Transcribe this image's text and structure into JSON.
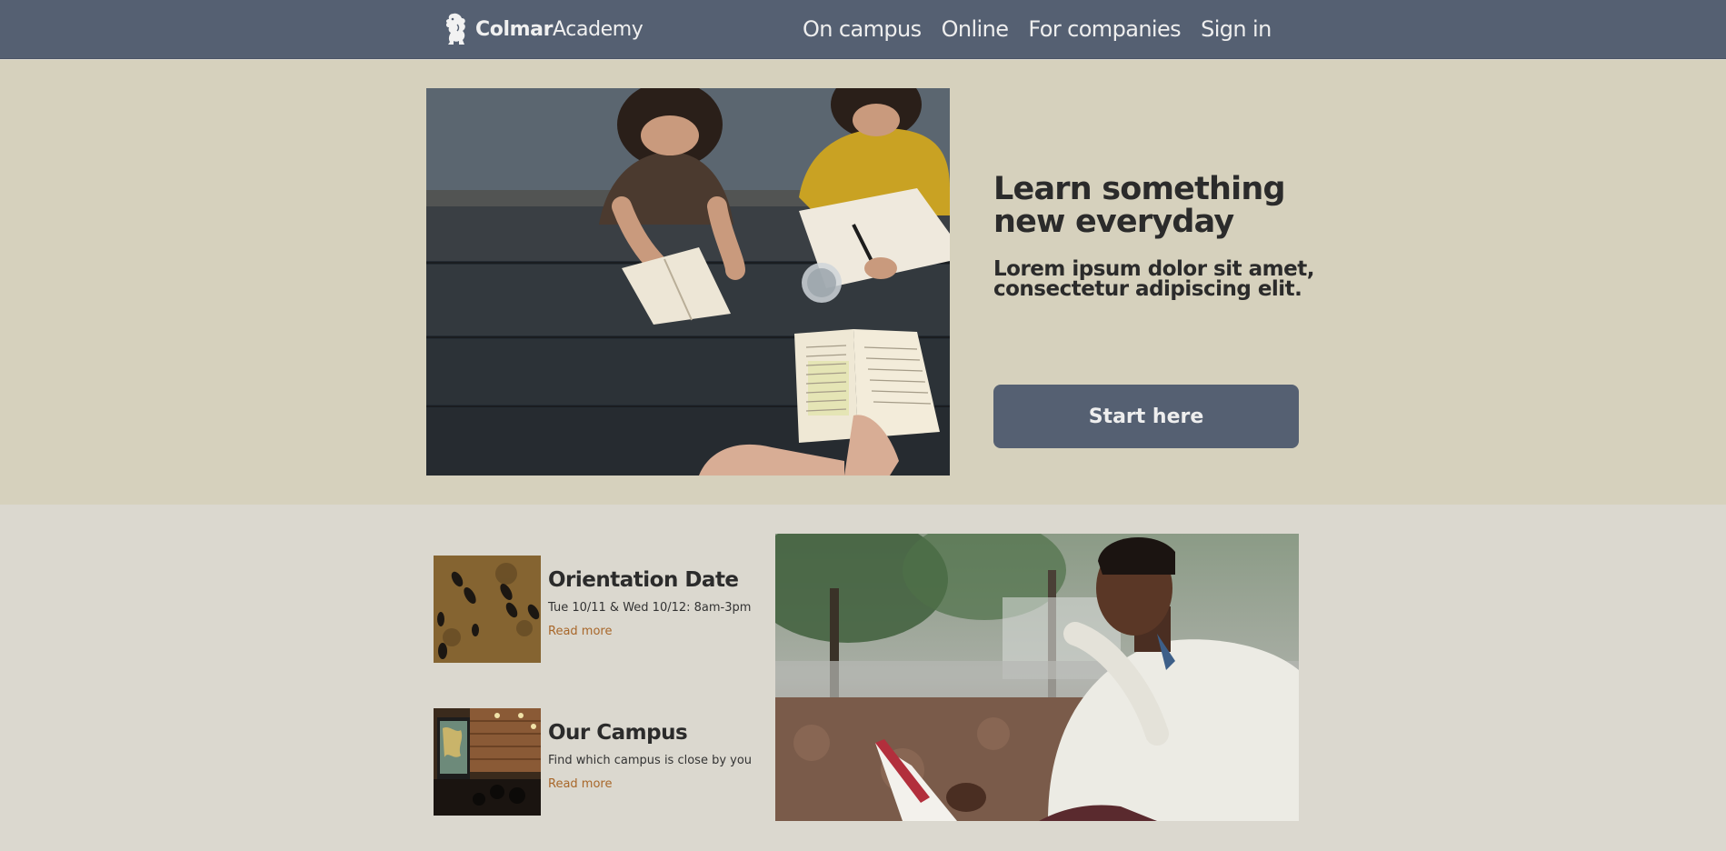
{
  "header": {
    "logo_bold": "Colmar",
    "logo_light": "Academy",
    "logo_icon": "lion-rampant-icon",
    "nav": [
      {
        "label": "On campus"
      },
      {
        "label": "Online"
      },
      {
        "label": "For companies"
      },
      {
        "label": "Sign in"
      }
    ]
  },
  "hero": {
    "title": "Learn something new everyday",
    "subtitle": "Lorem ipsum dolor sit amet, consectetur adipiscing elit.",
    "cta_label": "Start here",
    "photo": "students-reading-at-picnic-table"
  },
  "cards": [
    {
      "title": "Orientation Date",
      "desc": "Tue 10/11 & Wed 10/12: 8am-3pm",
      "link": "Read more",
      "thumb": "people-walking-aerial"
    },
    {
      "title": "Our Campus",
      "desc": "Find which campus is close by you",
      "link": "Read more",
      "thumb": "classroom-interior"
    }
  ],
  "lower_photo": "man-reading-book-outdoors",
  "colors": {
    "header_bg": "#556072",
    "hero_bg": "#d6d1bd",
    "page_bg": "#dbd8cf",
    "cta_bg": "#556072",
    "link": "#a8672a",
    "text_dark": "#2b2b2b"
  }
}
